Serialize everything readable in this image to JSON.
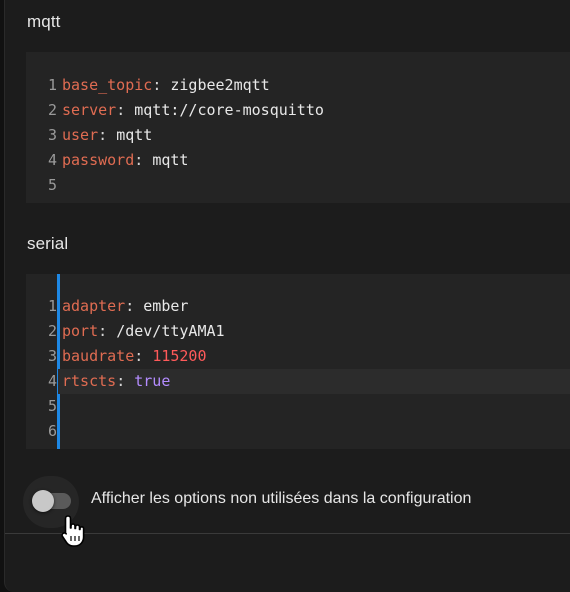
{
  "sections": {
    "mqtt": {
      "label": "mqtt",
      "lines": [
        {
          "num": "1",
          "key": "base_topic",
          "sep": ": ",
          "value": "zigbee2mqtt"
        },
        {
          "num": "2",
          "key": "server",
          "sep": ": ",
          "value": "mqtt://core-mosquitto"
        },
        {
          "num": "3",
          "key": "user",
          "sep": ": ",
          "value": "mqtt"
        },
        {
          "num": "4",
          "key": "password",
          "sep": ": ",
          "value": "mqtt"
        },
        {
          "num": "5",
          "key": "",
          "sep": "",
          "value": ""
        }
      ]
    },
    "serial": {
      "label": "serial",
      "lines": [
        {
          "num": "1",
          "key": "adapter",
          "sep": ": ",
          "value": "ember"
        },
        {
          "num": "2",
          "key": "port",
          "sep": ": ",
          "value": "/dev/ttyAMA1"
        },
        {
          "num": "3",
          "key": "baudrate",
          "sep": ": ",
          "value": "115200"
        },
        {
          "num": "4",
          "key": "rtscts",
          "sep": ": ",
          "value": "true"
        },
        {
          "num": "5",
          "key": "",
          "sep": "",
          "value": ""
        },
        {
          "num": "6",
          "key": "",
          "sep": "",
          "value": ""
        }
      ]
    }
  },
  "toggle": {
    "label": "Afficher les options non utilisées dans la configuration",
    "checked": false
  },
  "colors": {
    "key": "#e06c52",
    "number": "#ff5a5a",
    "boolean": "#b48cff",
    "active_cursor": "#1e88e5"
  }
}
